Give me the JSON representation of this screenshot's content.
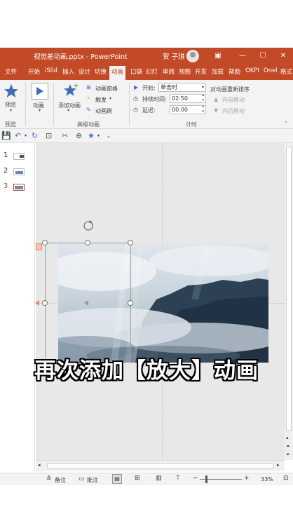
{
  "title_bar": {
    "doc_title": "视觉差动画.pptx - PowerPoint",
    "user_name": "贺 子琪"
  },
  "tabs": [
    "文件",
    "开始",
    "iSlid",
    "插入",
    "设计",
    "切换",
    "动画",
    "口袋",
    "幻灯",
    "审阅",
    "视图",
    "开发",
    "加载",
    "帮助",
    "OKPI",
    "Onel",
    "格式"
  ],
  "active_tab": "动画",
  "ribbon": {
    "preview_label": "预览",
    "preview_group": "预览",
    "animation_label": "动画",
    "add_animation_label": "添加动画",
    "animation_pane_label": "动画窗格",
    "trigger_label": "触发",
    "animation_painter_label": "动画刷",
    "advanced_group": "高级动画",
    "start_label": "开始:",
    "start_value": "单击时",
    "duration_label": "持续时间:",
    "duration_value": "02.50",
    "delay_label": "延迟:",
    "delay_value": "00.00",
    "timing_group": "计时",
    "reorder_title": "对动画重新排序",
    "move_earlier": "向前移动",
    "move_later": "向后移动"
  },
  "slides": [
    {
      "number": "1"
    },
    {
      "number": "2"
    },
    {
      "number": "3"
    }
  ],
  "active_slide": "3",
  "caption": "再次添加【放大】动画",
  "status": {
    "notes_label": "备注",
    "comments_label": "批注",
    "zoom": "33%"
  }
}
